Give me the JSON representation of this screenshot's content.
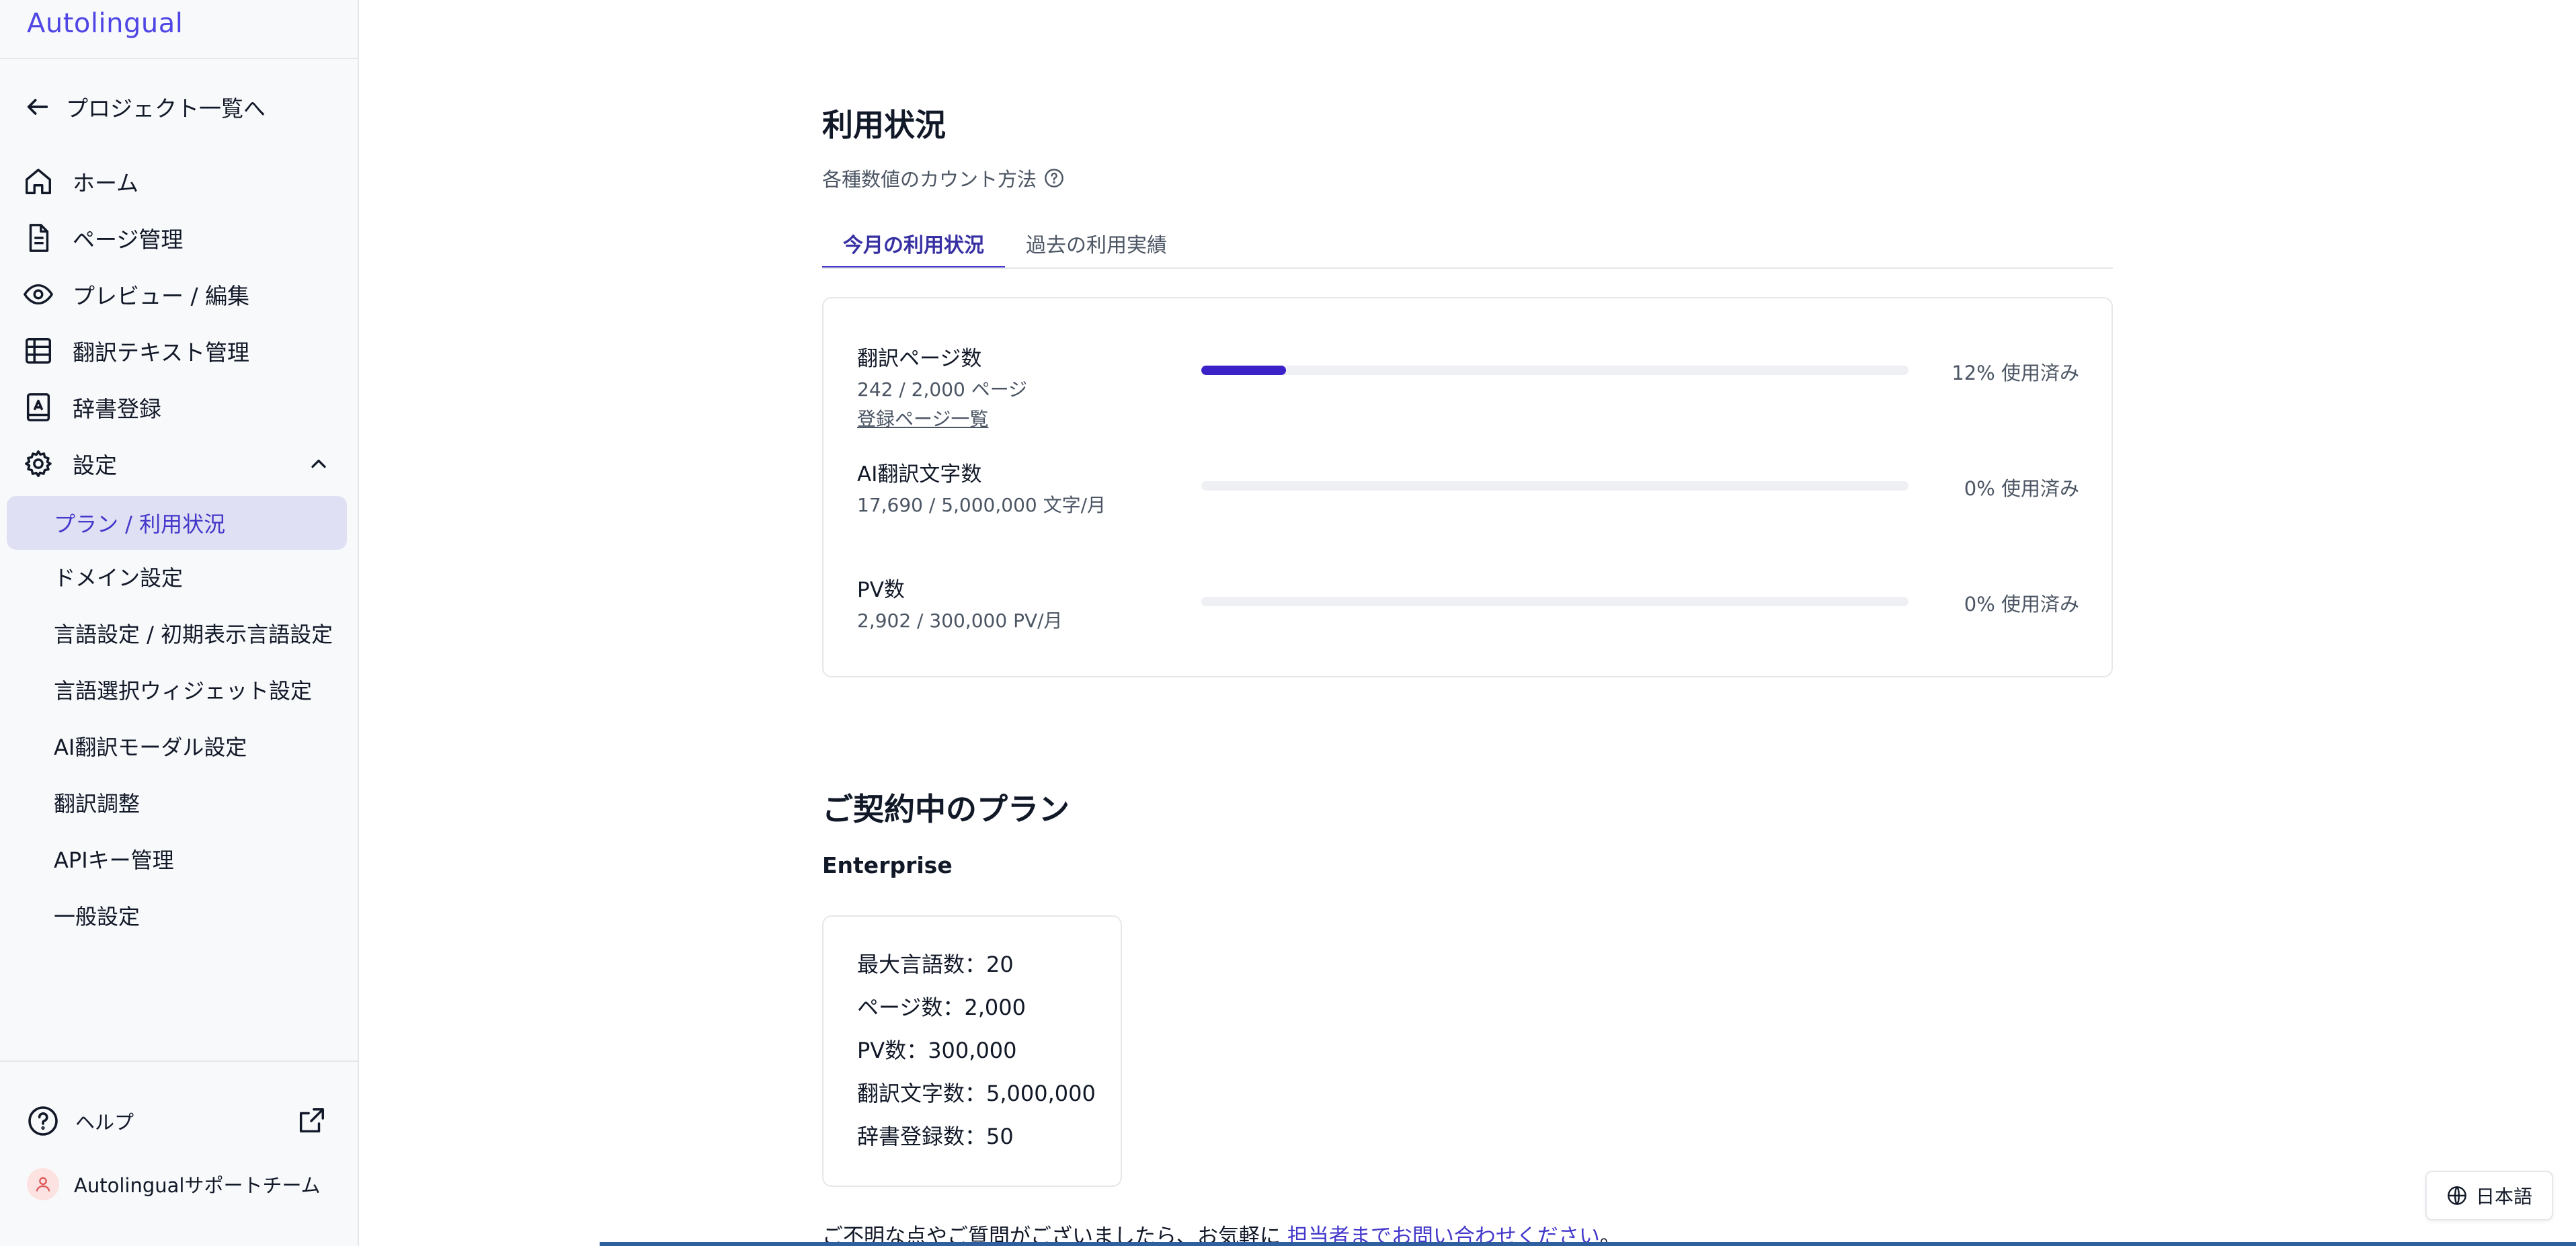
{
  "sidebar": {
    "logo": "Autolingual",
    "back_label": "プロジェクト一覧へ",
    "nav": {
      "home": "ホーム",
      "pages": "ページ管理",
      "preview": "プレビュー / 編集",
      "texts": "翻訳テキスト管理",
      "dictionary": "辞書登録",
      "settings": "設定"
    },
    "settings_items": [
      "プラン / 利用状況",
      "ドメイン設定",
      "言語設定 / 初期表示言語設定",
      "言語選択ウィジェット設定",
      "AI翻訳モーダル設定",
      "翻訳調整",
      "APIキー管理",
      "一般設定"
    ],
    "help_label": "ヘルプ",
    "user_name": "Autolingualサポートチーム"
  },
  "usage": {
    "title": "利用状況",
    "count_method": "各種数値のカウント方法",
    "tabs": [
      "今月の利用状況",
      "過去の利用実績"
    ],
    "rows": [
      {
        "label": "翻訳ページ数",
        "value": "242 / 2,000 ページ",
        "link": "登録ページ一覧",
        "progress": 0.12,
        "pct": "12% 使用済み"
      },
      {
        "label": "AI翻訳文字数",
        "value": "17,690 / 5,000,000 文字/月",
        "progress": 0.0,
        "pct": "0% 使用済み"
      },
      {
        "label": "PV数",
        "value": "2,902 / 300,000 PV/月",
        "progress": 0.0,
        "pct": "0% 使用済み"
      }
    ]
  },
  "plan": {
    "title": "ご契約中のプラン",
    "name": "Enterprise",
    "lines": [
      "最大言語数：20",
      "ページ数：2,000",
      "PV数：300,000",
      "翻訳文字数：5,000,000",
      "辞書登録数：50"
    ]
  },
  "footer": {
    "text": "ご不明な点やご質問がございましたら、お気軽に ",
    "link": "担当者までお問い合わせください",
    "suffix": "。"
  },
  "language_button": "日本語",
  "colors": {
    "accent": "#4338ca",
    "progress": "#3b21c8",
    "active_bg": "#e0e0f4"
  }
}
